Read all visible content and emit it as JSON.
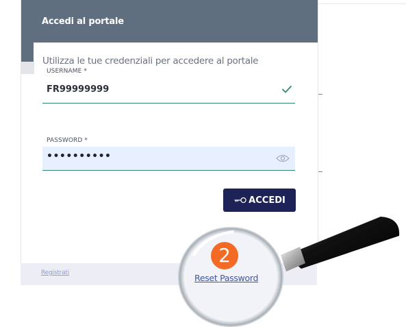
{
  "login": {
    "title": "Accedi al portale",
    "intro": "Utilizza le tue credenziali per accedere al portale",
    "username_label": "USERNAME *",
    "username_value": "FR99999999",
    "password_label": "PASSWORD *",
    "password_value": "••••••••••",
    "submit_label": "ACCEDI"
  },
  "footer": {
    "register_label": "Registrati",
    "reset_password_label": "Reset Password"
  },
  "annotation": {
    "step_number": "2"
  },
  "icons": {
    "username_status": "checkmark-icon",
    "password_toggle": "eye-icon",
    "submit": "key-icon",
    "overlay": "magnifying-glass-icon"
  },
  "colors": {
    "header": "#5f6f80",
    "primary_button": "#1e2357",
    "valid_underline": "#2e8a6b",
    "password_fill": "#e8efff",
    "step_badge": "#f36a24",
    "link": "#3a55b4"
  }
}
